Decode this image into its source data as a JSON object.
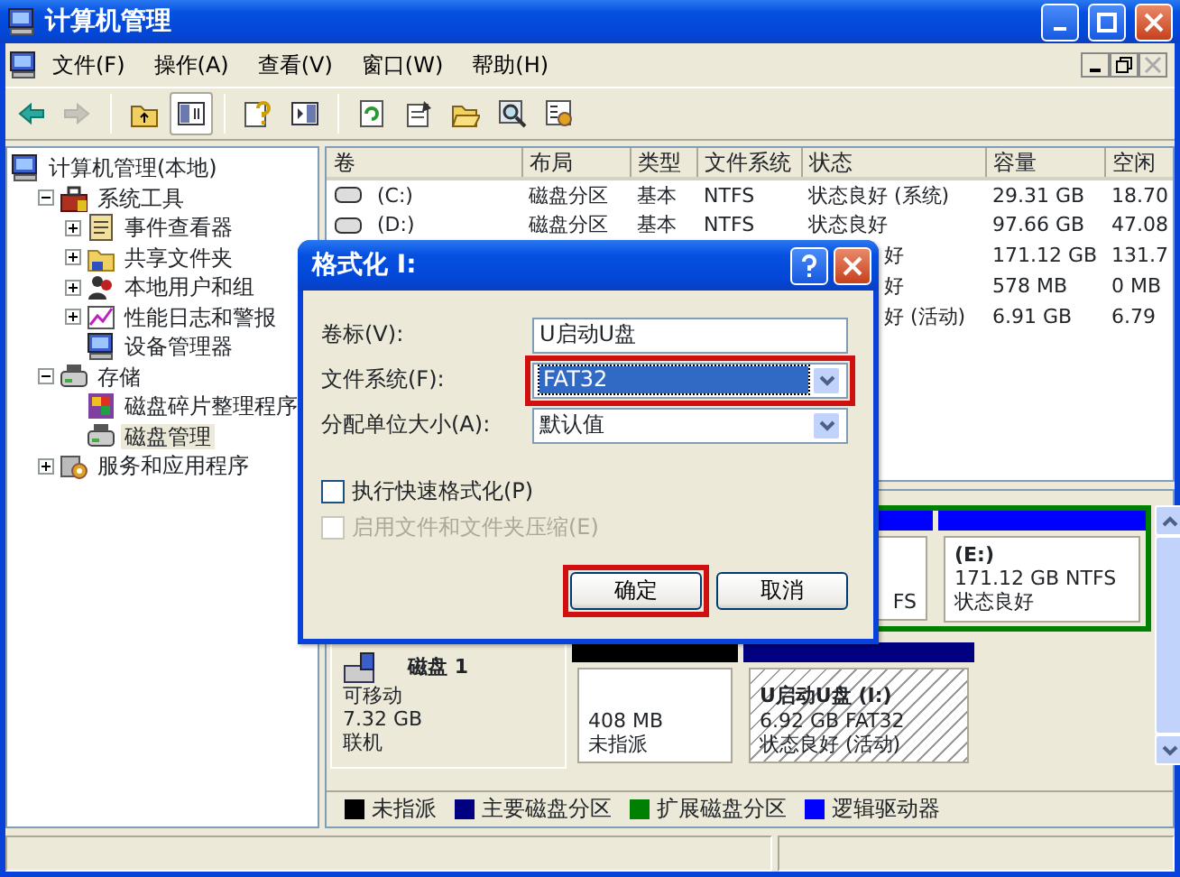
{
  "window": {
    "title": "计算机管理"
  },
  "menu": [
    "文件(F)",
    "操作(A)",
    "查看(V)",
    "窗口(W)",
    "帮助(H)"
  ],
  "toolbar": [
    [
      {
        "kind": "back",
        "disabled": false,
        "pressed": false
      },
      {
        "kind": "forward",
        "disabled": true,
        "pressed": false
      }
    ],
    [
      {
        "kind": "up",
        "disabled": false,
        "pressed": false
      },
      {
        "kind": "tree",
        "disabled": false,
        "pressed": true
      }
    ],
    [
      {
        "kind": "help",
        "disabled": false,
        "pressed": false
      },
      {
        "kind": "panel",
        "disabled": false,
        "pressed": false
      }
    ],
    [
      {
        "kind": "refresh",
        "disabled": false,
        "pressed": false
      },
      {
        "kind": "properties",
        "disabled": false,
        "pressed": false
      },
      {
        "kind": "open",
        "disabled": false,
        "pressed": false
      },
      {
        "kind": "find",
        "disabled": false,
        "pressed": false
      },
      {
        "kind": "manage",
        "disabled": false,
        "pressed": false
      }
    ]
  ],
  "tree": [
    {
      "label": "计算机管理(本地)",
      "kind": "computer",
      "selected": false,
      "children": [
        {
          "label": "系统工具",
          "kind": "tools",
          "selected": false,
          "expanded": true,
          "children": [
            {
              "label": "事件查看器",
              "kind": "events",
              "selected": false,
              "expanded": false
            },
            {
              "label": "共享文件夹",
              "kind": "folder",
              "selected": false,
              "expanded": false
            },
            {
              "label": "本地用户和组",
              "kind": "users",
              "selected": false,
              "expanded": false
            },
            {
              "label": "性能日志和警报",
              "kind": "chart",
              "selected": false,
              "expanded": false
            },
            {
              "label": "设备管理器",
              "kind": "computer",
              "selected": false
            }
          ]
        },
        {
          "label": "存储",
          "kind": "drive",
          "selected": false,
          "expanded": true,
          "children": [
            {
              "label": "磁盘碎片整理程序",
              "kind": "defrag",
              "selected": false
            },
            {
              "label": "磁盘管理",
              "kind": "drive",
              "selected": true
            }
          ]
        },
        {
          "label": "服务和应用程序",
          "kind": "services",
          "selected": false,
          "expanded": false
        }
      ]
    }
  ],
  "volume_table": {
    "columns": [
      "卷",
      "布局",
      "类型",
      "文件系统",
      "状态",
      "容量",
      "空闲"
    ],
    "rows": [
      {
        "volume": "(C:)",
        "layout": "磁盘分区",
        "type": "基本",
        "file_system": "NTFS",
        "status": "状态良好 (系统)",
        "capacity": "29.31 GB",
        "free": "18.70"
      },
      {
        "volume": "(D:)",
        "layout": "磁盘分区",
        "type": "基本",
        "file_system": "NTFS",
        "status": "状态良好",
        "capacity": "97.66 GB",
        "free": "47.08"
      },
      {
        "status": "好",
        "capacity": "171.12 GB",
        "free": "131.7"
      },
      {
        "status": "好",
        "capacity": "578 MB",
        "free": "0 MB"
      },
      {
        "status": "好 (活动)",
        "capacity": "6.91 GB",
        "free": "6.79"
      }
    ]
  },
  "disks": [
    {
      "extended_partition": {
        "color": "#008000",
        "partitions": [
          {
            "color": "#0000ff",
            "lines": [
              "FS"
            ],
            "selected": false
          },
          {
            "color": "#0000ff",
            "title": "(E:)",
            "lines": [
              "171.12 GB NTFS",
              "状态良好"
            ],
            "selected": false
          }
        ]
      }
    },
    {
      "name": "磁盘 1",
      "type": "可移动",
      "size": "7.32 GB",
      "state": "联机",
      "partitions": [
        {
          "color": "#000000",
          "lines": [
            "408 MB",
            "未指派"
          ],
          "selected": false
        },
        {
          "color": "#000080",
          "title": "U启动U盘 (I:)",
          "lines": [
            "6.92 GB FAT32",
            "状态良好 (活动)"
          ],
          "selected": true
        }
      ]
    }
  ],
  "legend": [
    {
      "label": "未指派",
      "color": "#000000"
    },
    {
      "label": "主要磁盘分区",
      "color": "#000080"
    },
    {
      "label": "扩展磁盘分区",
      "color": "#008000"
    },
    {
      "label": "逻辑驱动器",
      "color": "#0000ff"
    }
  ],
  "dialog": {
    "title": "格式化 I:",
    "fields": [
      {
        "kind": "text",
        "label": "卷标(V):",
        "value": "U启动U盘",
        "focused": false,
        "highlighted": false
      },
      {
        "kind": "select",
        "label": "文件系统(F):",
        "value": "FAT32",
        "focused": true,
        "highlighted": true
      },
      {
        "kind": "select",
        "label": "分配单位大小(A):",
        "value": "默认值",
        "focused": false,
        "highlighted": false
      }
    ],
    "checkboxes": [
      {
        "label": "执行快速格式化(P)",
        "checked": false,
        "disabled": false
      },
      {
        "label": "启用文件和文件夹压缩(E)",
        "checked": false,
        "disabled": true
      }
    ],
    "buttons": [
      {
        "label": "确定",
        "highlighted": true
      },
      {
        "label": "取消",
        "highlighted": false
      }
    ]
  }
}
